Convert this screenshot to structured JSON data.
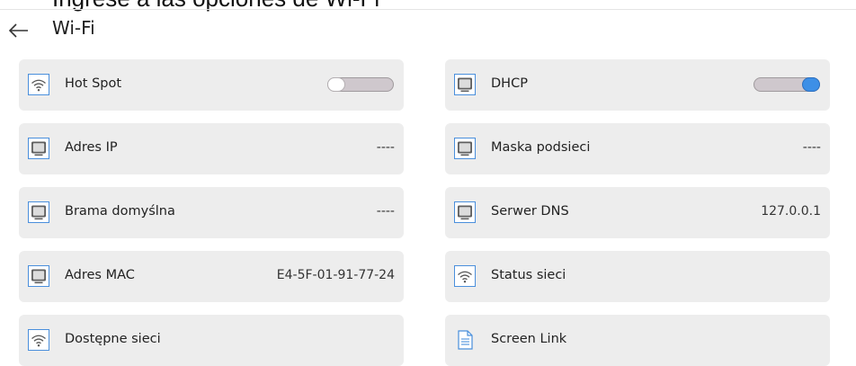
{
  "caption": "Ingrese a las opciones de Wi-Fi",
  "header": {
    "title": "Wi-Fi",
    "back_icon": "arrow-left-icon"
  },
  "accent_color": "#3d8fe6",
  "left": [
    {
      "key": "hot_spot",
      "label": "Hot Spot",
      "icon": "wifi-icon",
      "toggle": false
    },
    {
      "key": "ip_address",
      "label": "Adres IP",
      "icon": "monitor-icon",
      "value": "----"
    },
    {
      "key": "gateway",
      "label": "Brama domyślna",
      "icon": "monitor-icon",
      "value": "----"
    },
    {
      "key": "mac",
      "label": "Adres MAC",
      "icon": "monitor-icon",
      "value": "E4-5F-01-91-77-24"
    },
    {
      "key": "available_networks",
      "label": "Dostępne sieci",
      "icon": "wifi-icon"
    }
  ],
  "right": [
    {
      "key": "dhcp",
      "label": "DHCP",
      "icon": "monitor-icon",
      "toggle": true
    },
    {
      "key": "subnet_mask",
      "label": "Maska podsieci",
      "icon": "monitor-icon",
      "value": "----"
    },
    {
      "key": "dns",
      "label": "Serwer DNS",
      "icon": "monitor-icon",
      "value": "127.0.0.1"
    },
    {
      "key": "network_status",
      "label": "Status sieci",
      "icon": "wifi-icon"
    },
    {
      "key": "screen_link",
      "label": "Screen Link",
      "icon": "document-icon"
    }
  ]
}
